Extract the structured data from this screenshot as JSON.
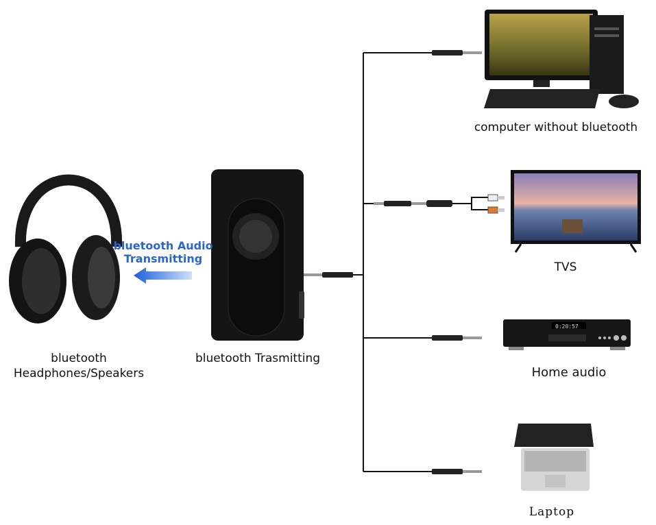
{
  "headphones": {
    "label_line1": "bluetooth",
    "label_line2": "Headphones/Speakers"
  },
  "transmit_caption": {
    "line1": "bluetooth Audio",
    "line2": "Transmitting",
    "color": "#2a67c9"
  },
  "transmitter": {
    "label": "bluetooth Trasmitting"
  },
  "devices": [
    {
      "label": "computer without bluetooth"
    },
    {
      "label": "TVS"
    },
    {
      "label": "Home audio"
    },
    {
      "label": "Laptop"
    }
  ]
}
